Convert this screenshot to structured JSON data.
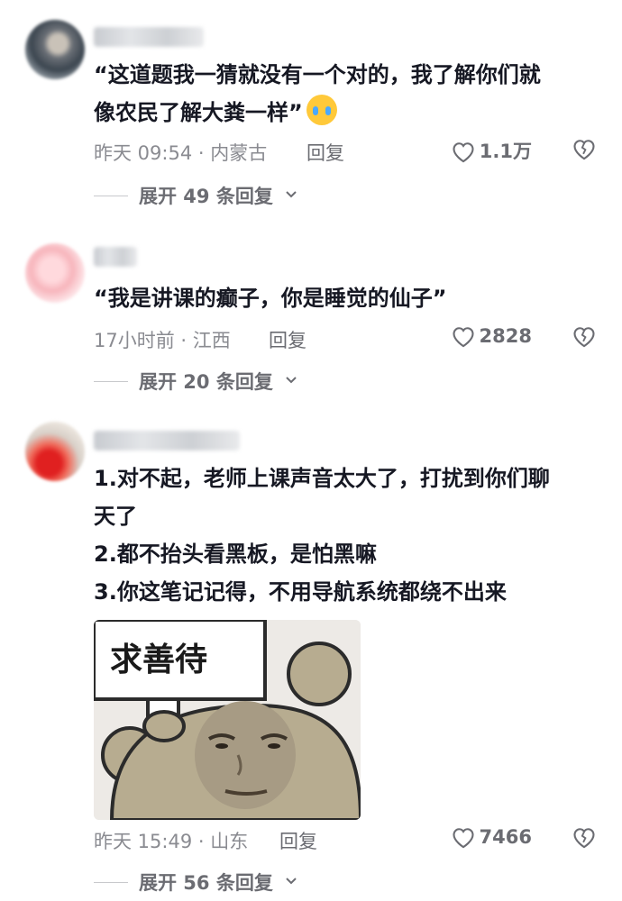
{
  "comments": [
    {
      "lines": [
        "“这道题我一猜就没有一个对的，我了解你们就",
        "像农民了解大粪一样”"
      ],
      "emoji": "crying-emoji",
      "time": "昨天 09:54 · 内蒙古",
      "reply": "回复",
      "likes": "1.1万",
      "expand": "展开 49 条回复"
    },
    {
      "lines": [
        "“我是讲课的癫子，你是睡觉的仙子”"
      ],
      "time": "17小时前 · 江西",
      "reply": "回复",
      "likes": "2828",
      "expand": "展开 20 条回复"
    },
    {
      "lines": [
        "1.对不起，老师上课声音太大了，打扰到你们聊",
        "天了",
        "2.都不抬头看黑板，是怕黑嘛",
        "3.你这笔记记得，不用导航系统都绕不出来"
      ],
      "sticker_text": "求善待",
      "time": "昨天 15:49 · 山东",
      "reply": "回复",
      "likes": "7466",
      "expand": "展开 56 条回复"
    }
  ],
  "colors": {
    "text": "#161823",
    "meta": "#8a8b91",
    "secondary": "#6b6c72",
    "divider": "#c8c9cc"
  },
  "icons": [
    "heart-outline-icon",
    "broken-heart-icon",
    "chevron-down-icon"
  ]
}
